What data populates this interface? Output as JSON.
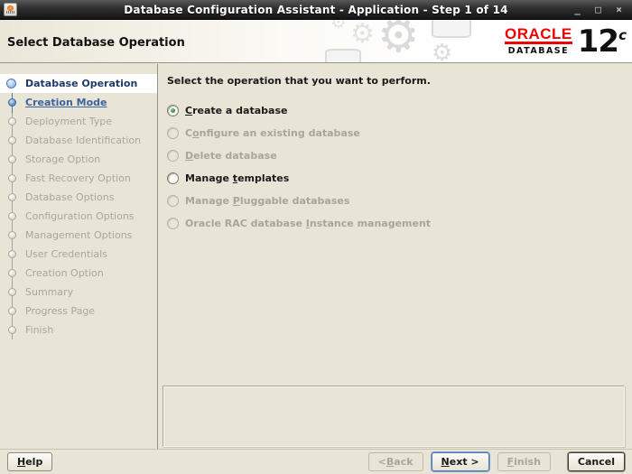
{
  "window": {
    "title": "Database Configuration Assistant - Application - Step 1 of 14",
    "controls": {
      "minimize": "_",
      "maximize": "□",
      "close": "×"
    }
  },
  "header": {
    "title": "Select Database Operation",
    "brand": {
      "name": "ORACLE",
      "product": "DATABASE",
      "version": "12",
      "version_suffix": "c"
    },
    "gear_glyph": "⚙"
  },
  "sidebar": {
    "steps": [
      {
        "label": "Database Operation",
        "state": "current"
      },
      {
        "label": "Creation Mode",
        "state": "link"
      },
      {
        "label": "Deployment Type",
        "state": "disabled"
      },
      {
        "label": "Database Identification",
        "state": "disabled"
      },
      {
        "label": "Storage Option",
        "state": "disabled"
      },
      {
        "label": "Fast Recovery Option",
        "state": "disabled"
      },
      {
        "label": "Database Options",
        "state": "disabled"
      },
      {
        "label": "Configuration Options",
        "state": "disabled"
      },
      {
        "label": "Management Options",
        "state": "disabled"
      },
      {
        "label": "User Credentials",
        "state": "disabled"
      },
      {
        "label": "Creation Option",
        "state": "disabled"
      },
      {
        "label": "Summary",
        "state": "disabled"
      },
      {
        "label": "Progress Page",
        "state": "disabled"
      },
      {
        "label": "Finish",
        "state": "disabled"
      }
    ]
  },
  "main": {
    "instruction": "Select the operation that you want to perform.",
    "options": [
      {
        "label": "Create a database",
        "mnemonic": 0,
        "selected": true,
        "enabled": true
      },
      {
        "label": "Configure an existing database",
        "mnemonic": 1,
        "selected": false,
        "enabled": false
      },
      {
        "label": "Delete database",
        "mnemonic": 0,
        "selected": false,
        "enabled": false
      },
      {
        "label": "Manage templates",
        "mnemonic": 7,
        "selected": false,
        "enabled": true
      },
      {
        "label": "Manage Pluggable databases",
        "mnemonic": 7,
        "selected": false,
        "enabled": false
      },
      {
        "label": "Oracle RAC database Instance management",
        "mnemonic": 20,
        "selected": false,
        "enabled": false
      }
    ]
  },
  "footer": {
    "help": {
      "label": "Help",
      "mnemonic": 0,
      "enabled": true,
      "style": "normal"
    },
    "buttons": [
      {
        "name": "back",
        "label": "< Back",
        "mnemonic": 2,
        "enabled": false,
        "style": "normal"
      },
      {
        "name": "next",
        "label": "Next >",
        "mnemonic": 0,
        "enabled": true,
        "style": "focused"
      },
      {
        "name": "finish",
        "label": "Finish",
        "mnemonic": 0,
        "enabled": false,
        "style": "normal"
      },
      {
        "name": "cancel",
        "label": "Cancel",
        "mnemonic": -1,
        "enabled": true,
        "style": "default"
      }
    ]
  },
  "colors": {
    "accent_red": "#f00000",
    "titlebar": "#2e2e2e",
    "background_beige": "#e9e5d6",
    "current_step_text": "#1f3a68",
    "link_step_text": "#3c62a0",
    "disabled_text": "#a9a697",
    "radio_selected_dot": "#2e7d32"
  }
}
